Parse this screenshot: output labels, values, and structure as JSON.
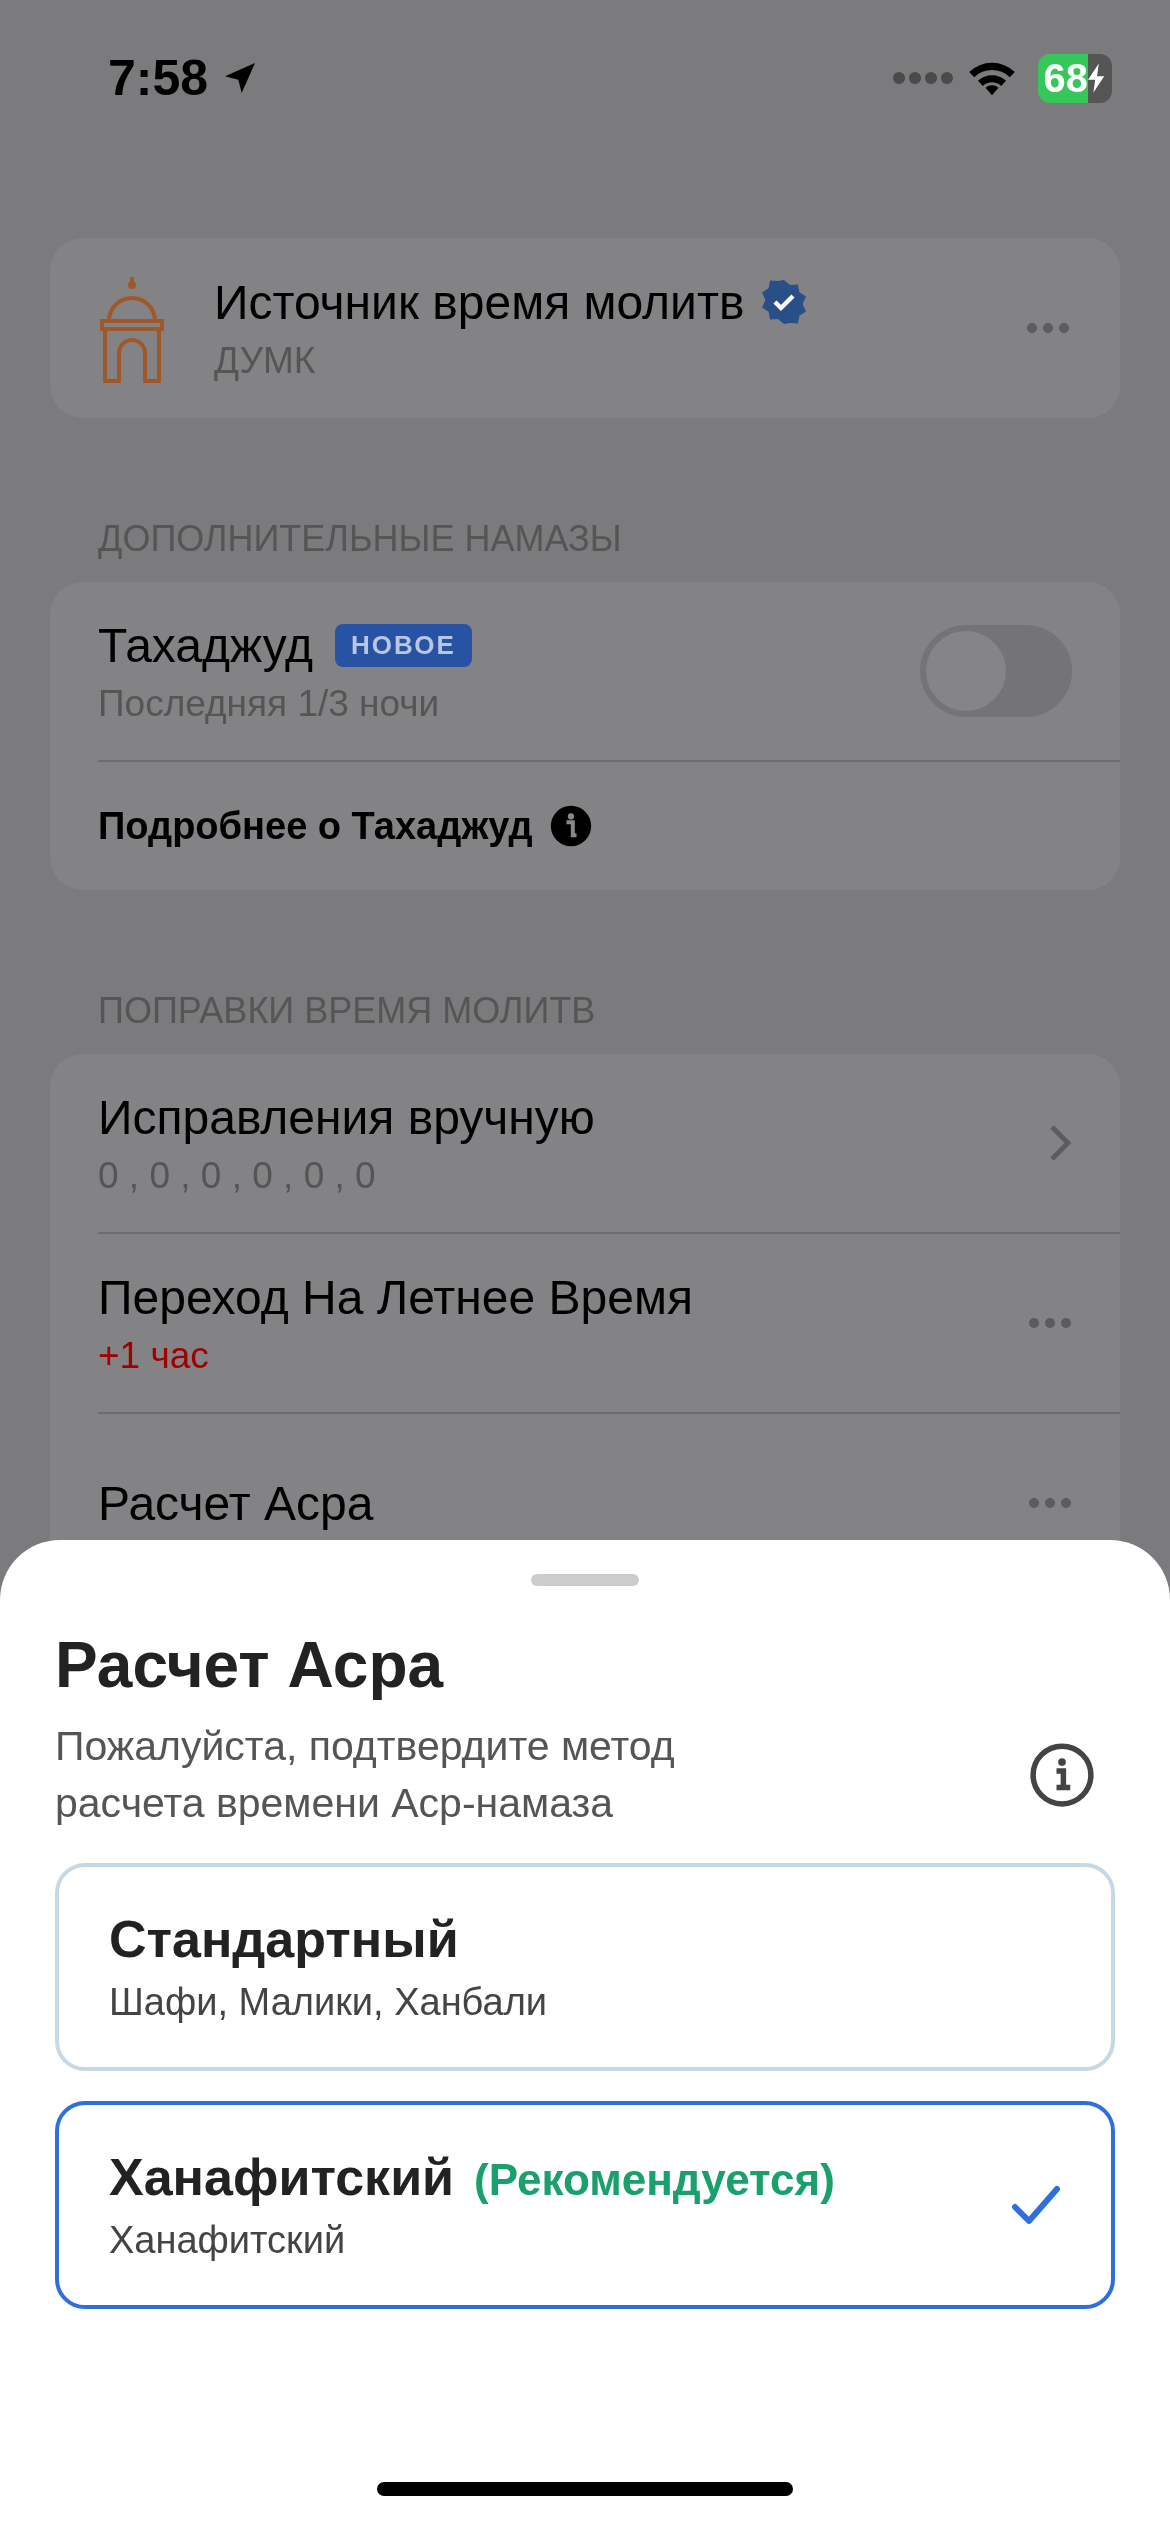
{
  "status_bar": {
    "time": "7:58",
    "battery": "68"
  },
  "source_card": {
    "title": "Источник время молитв",
    "subtitle": "ДУМК"
  },
  "sections": [
    {
      "header": "ДОПОЛНИТЕЛЬНЫЕ НАМАЗЫ",
      "rows": [
        {
          "kind": "toggle",
          "title": "Тахаджуд",
          "badge": "НОВОЕ",
          "subtitle": "Последняя 1/3 ночи",
          "on": false
        },
        {
          "kind": "info",
          "title": "Подробнее о Тахаджуд"
        }
      ]
    },
    {
      "header": "ПОПРАВКИ ВРЕМЯ МОЛИТВ",
      "rows": [
        {
          "kind": "chevron",
          "title": "Исправления вручную",
          "subtitle": "0 , 0 , 0 , 0 , 0 , 0",
          "warning": false
        },
        {
          "kind": "more",
          "title": "Переход На Летнее Время",
          "subtitle": "+1 час",
          "warning": true
        },
        {
          "kind": "more",
          "title": "Расчет Асра"
        }
      ]
    }
  ],
  "sheet": {
    "title": "Расчет Асра",
    "description": "Пожалуйста, подтвердите метод расчета времени Аср-намаза",
    "options": [
      {
        "title": "Стандартный",
        "subtitle": "Шафи, Малики, Ханбали",
        "selected": false
      },
      {
        "title": "Ханафитский",
        "tag": "(Рекомендуется)",
        "subtitle": "Ханафитский",
        "selected": true
      }
    ]
  }
}
